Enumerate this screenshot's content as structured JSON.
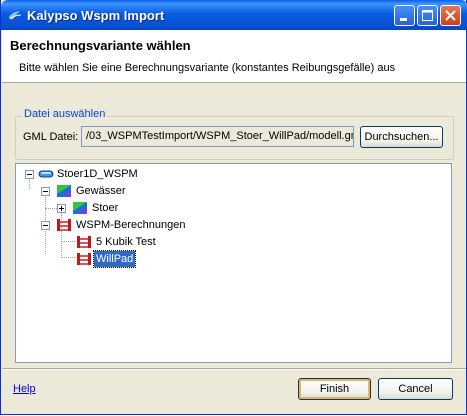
{
  "window": {
    "title": "Kalypso Wspm Import",
    "controls": [
      "minimize-icon",
      "maximize-icon",
      "close-icon"
    ]
  },
  "header": {
    "title": "Berechnungsvariante wählen",
    "description": "Bitte wählen Sie eine Berechnungsvariante (konstantes Reibungsgefälle) aus"
  },
  "file_group": {
    "legend": "Datei auswählen",
    "gml_label": "GML Datei:",
    "gml_value": "/03_WSPMTestImport/WSPM_Stoer_WillPad/modell.gn",
    "browse_label": "Durchsuchen..."
  },
  "tree": {
    "root": {
      "label": "Stoer1D_WSPM",
      "icon": "project-icon",
      "expanded": true
    },
    "waters": {
      "label": "Gewässer",
      "icon": "water-icon",
      "expanded": true
    },
    "water_item": {
      "label": "Stoer",
      "icon": "water-icon",
      "expanded": false
    },
    "calculations": {
      "label": "WSPM-Berechnungen",
      "icon": "calculation-icon",
      "expanded": true
    },
    "calc_items": [
      {
        "label": "5 Kubik Test",
        "icon": "calculation-icon",
        "selected": false
      },
      {
        "label": "WillPad",
        "icon": "calculation-icon",
        "selected": true
      }
    ]
  },
  "footer": {
    "help_label": "Help",
    "finish_label": "Finish",
    "cancel_label": "Cancel"
  },
  "colors": {
    "titlebar": "#0b5ce1",
    "selection": "#316ac5",
    "link": "#0000ff",
    "legend": "#0046d5"
  }
}
